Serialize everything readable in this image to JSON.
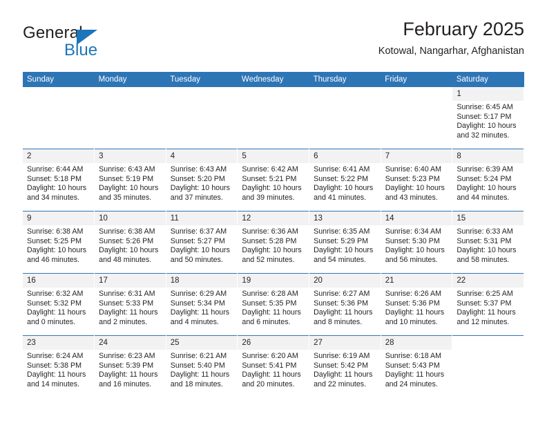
{
  "brand": {
    "name_top": "General",
    "name_bottom": "Blue",
    "accent_color": "#1b75bb"
  },
  "header": {
    "title": "February 2025",
    "location": "Kotowal, Nangarhar, Afghanistan"
  },
  "theme": {
    "header_blue": "#2e75b6",
    "daynum_band": "#f2f2f2",
    "text": "#231f20"
  },
  "weekdays": [
    "Sunday",
    "Monday",
    "Tuesday",
    "Wednesday",
    "Thursday",
    "Friday",
    "Saturday"
  ],
  "weeks": [
    [
      {
        "day": "",
        "lines": []
      },
      {
        "day": "",
        "lines": []
      },
      {
        "day": "",
        "lines": []
      },
      {
        "day": "",
        "lines": []
      },
      {
        "day": "",
        "lines": []
      },
      {
        "day": "",
        "lines": []
      },
      {
        "day": "1",
        "lines": [
          "Sunrise: 6:45 AM",
          "Sunset: 5:17 PM",
          "Daylight: 10 hours",
          "and 32 minutes."
        ]
      }
    ],
    [
      {
        "day": "2",
        "lines": [
          "Sunrise: 6:44 AM",
          "Sunset: 5:18 PM",
          "Daylight: 10 hours",
          "and 34 minutes."
        ]
      },
      {
        "day": "3",
        "lines": [
          "Sunrise: 6:43 AM",
          "Sunset: 5:19 PM",
          "Daylight: 10 hours",
          "and 35 minutes."
        ]
      },
      {
        "day": "4",
        "lines": [
          "Sunrise: 6:43 AM",
          "Sunset: 5:20 PM",
          "Daylight: 10 hours",
          "and 37 minutes."
        ]
      },
      {
        "day": "5",
        "lines": [
          "Sunrise: 6:42 AM",
          "Sunset: 5:21 PM",
          "Daylight: 10 hours",
          "and 39 minutes."
        ]
      },
      {
        "day": "6",
        "lines": [
          "Sunrise: 6:41 AM",
          "Sunset: 5:22 PM",
          "Daylight: 10 hours",
          "and 41 minutes."
        ]
      },
      {
        "day": "7",
        "lines": [
          "Sunrise: 6:40 AM",
          "Sunset: 5:23 PM",
          "Daylight: 10 hours",
          "and 43 minutes."
        ]
      },
      {
        "day": "8",
        "lines": [
          "Sunrise: 6:39 AM",
          "Sunset: 5:24 PM",
          "Daylight: 10 hours",
          "and 44 minutes."
        ]
      }
    ],
    [
      {
        "day": "9",
        "lines": [
          "Sunrise: 6:38 AM",
          "Sunset: 5:25 PM",
          "Daylight: 10 hours",
          "and 46 minutes."
        ]
      },
      {
        "day": "10",
        "lines": [
          "Sunrise: 6:38 AM",
          "Sunset: 5:26 PM",
          "Daylight: 10 hours",
          "and 48 minutes."
        ]
      },
      {
        "day": "11",
        "lines": [
          "Sunrise: 6:37 AM",
          "Sunset: 5:27 PM",
          "Daylight: 10 hours",
          "and 50 minutes."
        ]
      },
      {
        "day": "12",
        "lines": [
          "Sunrise: 6:36 AM",
          "Sunset: 5:28 PM",
          "Daylight: 10 hours",
          "and 52 minutes."
        ]
      },
      {
        "day": "13",
        "lines": [
          "Sunrise: 6:35 AM",
          "Sunset: 5:29 PM",
          "Daylight: 10 hours",
          "and 54 minutes."
        ]
      },
      {
        "day": "14",
        "lines": [
          "Sunrise: 6:34 AM",
          "Sunset: 5:30 PM",
          "Daylight: 10 hours",
          "and 56 minutes."
        ]
      },
      {
        "day": "15",
        "lines": [
          "Sunrise: 6:33 AM",
          "Sunset: 5:31 PM",
          "Daylight: 10 hours",
          "and 58 minutes."
        ]
      }
    ],
    [
      {
        "day": "16",
        "lines": [
          "Sunrise: 6:32 AM",
          "Sunset: 5:32 PM",
          "Daylight: 11 hours",
          "and 0 minutes."
        ]
      },
      {
        "day": "17",
        "lines": [
          "Sunrise: 6:31 AM",
          "Sunset: 5:33 PM",
          "Daylight: 11 hours",
          "and 2 minutes."
        ]
      },
      {
        "day": "18",
        "lines": [
          "Sunrise: 6:29 AM",
          "Sunset: 5:34 PM",
          "Daylight: 11 hours",
          "and 4 minutes."
        ]
      },
      {
        "day": "19",
        "lines": [
          "Sunrise: 6:28 AM",
          "Sunset: 5:35 PM",
          "Daylight: 11 hours",
          "and 6 minutes."
        ]
      },
      {
        "day": "20",
        "lines": [
          "Sunrise: 6:27 AM",
          "Sunset: 5:36 PM",
          "Daylight: 11 hours",
          "and 8 minutes."
        ]
      },
      {
        "day": "21",
        "lines": [
          "Sunrise: 6:26 AM",
          "Sunset: 5:36 PM",
          "Daylight: 11 hours",
          "and 10 minutes."
        ]
      },
      {
        "day": "22",
        "lines": [
          "Sunrise: 6:25 AM",
          "Sunset: 5:37 PM",
          "Daylight: 11 hours",
          "and 12 minutes."
        ]
      }
    ],
    [
      {
        "day": "23",
        "lines": [
          "Sunrise: 6:24 AM",
          "Sunset: 5:38 PM",
          "Daylight: 11 hours",
          "and 14 minutes."
        ]
      },
      {
        "day": "24",
        "lines": [
          "Sunrise: 6:23 AM",
          "Sunset: 5:39 PM",
          "Daylight: 11 hours",
          "and 16 minutes."
        ]
      },
      {
        "day": "25",
        "lines": [
          "Sunrise: 6:21 AM",
          "Sunset: 5:40 PM",
          "Daylight: 11 hours",
          "and 18 minutes."
        ]
      },
      {
        "day": "26",
        "lines": [
          "Sunrise: 6:20 AM",
          "Sunset: 5:41 PM",
          "Daylight: 11 hours",
          "and 20 minutes."
        ]
      },
      {
        "day": "27",
        "lines": [
          "Sunrise: 6:19 AM",
          "Sunset: 5:42 PM",
          "Daylight: 11 hours",
          "and 22 minutes."
        ]
      },
      {
        "day": "28",
        "lines": [
          "Sunrise: 6:18 AM",
          "Sunset: 5:43 PM",
          "Daylight: 11 hours",
          "and 24 minutes."
        ]
      },
      {
        "day": "",
        "lines": []
      }
    ]
  ]
}
